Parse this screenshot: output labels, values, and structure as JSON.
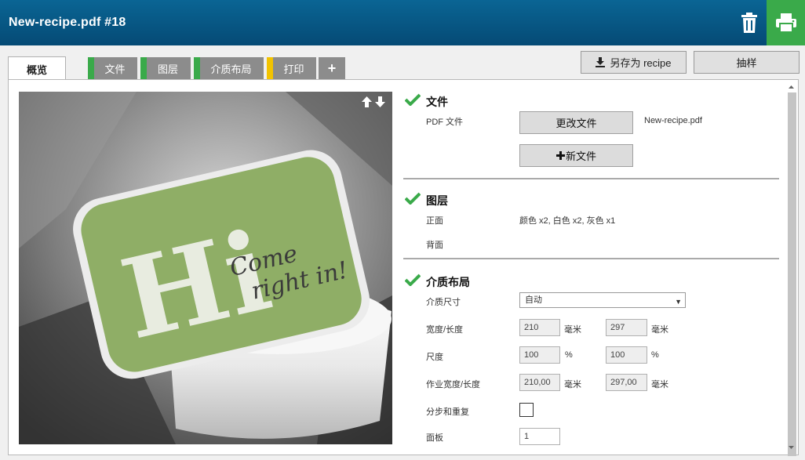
{
  "header": {
    "title": "New-recipe.pdf #18"
  },
  "tabs": [
    {
      "label": "概览"
    },
    {
      "label": "文件",
      "stripe_color": "#3aaa4a"
    },
    {
      "label": "图层",
      "stripe_color": "#3aaa4a"
    },
    {
      "label": "介质布局",
      "stripe_color": "#3aaa4a"
    },
    {
      "label": "打印",
      "stripe_color": "#f2c300"
    },
    {
      "label": "+"
    }
  ],
  "actions": {
    "save_as": "另存为 recipe",
    "sample": "抽样"
  },
  "preview": {
    "text_hi": "Hi",
    "text_come": "Come",
    "text_right_in": "right in!"
  },
  "sections": {
    "file": {
      "title": "文件",
      "pdf_label": "PDF 文件",
      "change_button": "更改文件",
      "filename": "New-recipe.pdf",
      "new_button": "新文件"
    },
    "layers": {
      "title": "图层",
      "front_label": "正面",
      "front_value": "颜色 x2, 白色 x2, 灰色 x1",
      "back_label": "背面"
    },
    "media": {
      "title": "介质布局",
      "size_label": "介质尺寸",
      "size_value": "自动",
      "width_length_label": "宽度/长度",
      "width": "210",
      "length": "297",
      "unit_mm": "毫米",
      "scale_label": "尺度",
      "scale_x": "100",
      "scale_y": "100",
      "unit_pct": "%",
      "job_size_label": "作业宽度/长度",
      "job_width": "210,00",
      "job_length": "297,00",
      "step_repeat_label": "分步和重复",
      "panels_label": "面板",
      "panels_value": "1"
    }
  },
  "colors": {
    "header_bg": "#05527f",
    "accent_green": "#3aaa4a",
    "accent_yellow": "#f2c300"
  }
}
